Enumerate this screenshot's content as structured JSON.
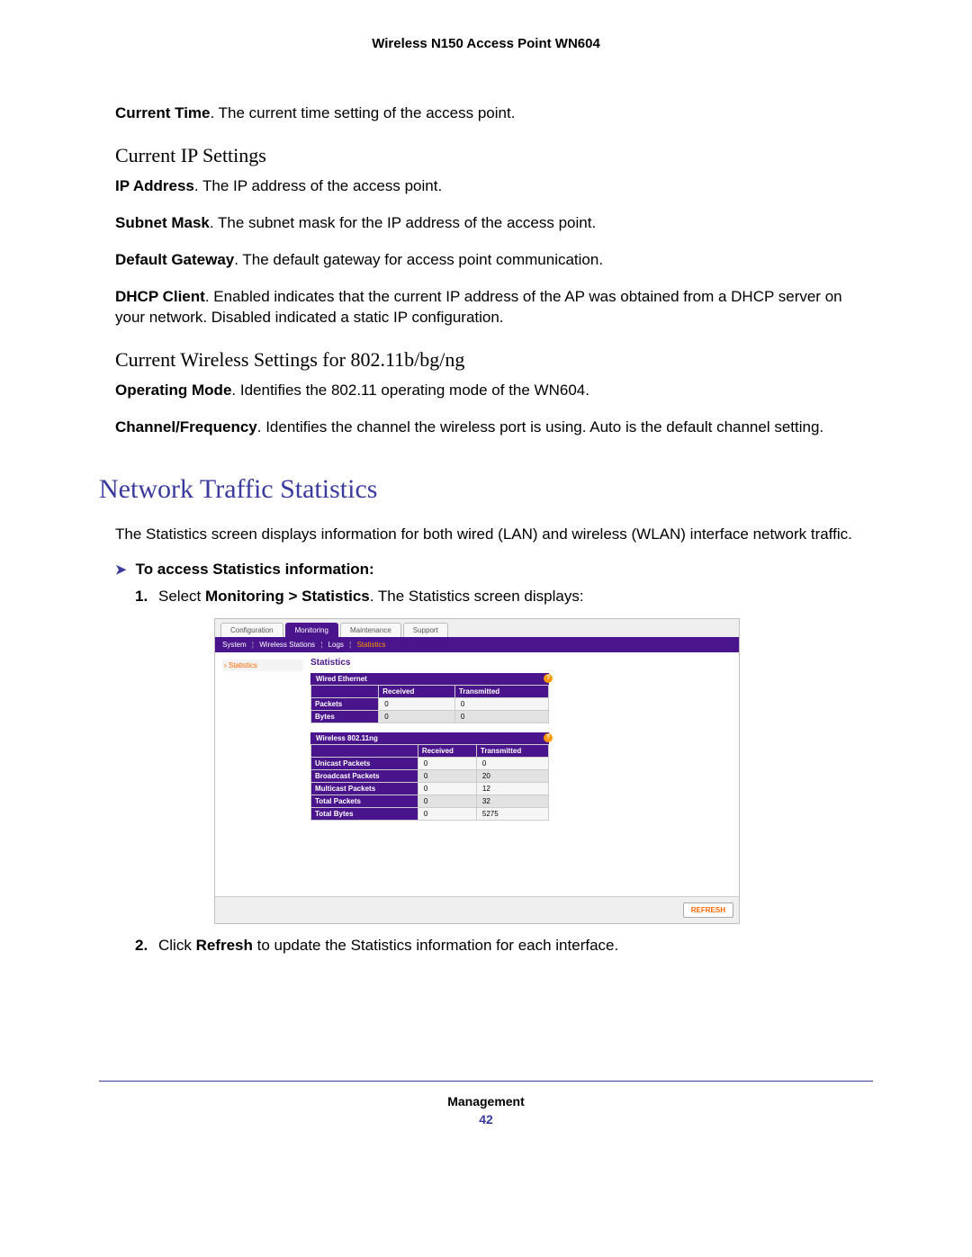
{
  "header": {
    "product": "Wireless N150 Access Point WN604"
  },
  "current_time": {
    "term": "Current Time",
    "desc": ". The current time setting of the access point."
  },
  "ip_section": {
    "heading": "Current IP Settings",
    "ip_address": {
      "term": "IP Address",
      "desc": ". The IP address of the access point."
    },
    "subnet_mask": {
      "term": "Subnet Mask",
      "desc": ". The subnet mask for the IP address of the access point."
    },
    "default_gw": {
      "term": "Default Gateway",
      "desc": ". The default gateway for access point communication."
    },
    "dhcp": {
      "term": "DHCP Client",
      "desc": ". Enabled indicates that the current IP address of the AP was obtained from a DHCP server on your network. Disabled indicated a static IP configuration."
    }
  },
  "wireless_section": {
    "heading": "Current Wireless Settings for 802.11b/bg/ng",
    "op_mode": {
      "term": "Operating Mode",
      "desc": ". Identifies the 802.11 operating mode of the WN604."
    },
    "channel": {
      "term": "Channel/Frequency",
      "desc": ". Identifies the channel the wireless port is using. Auto is the default channel setting."
    }
  },
  "stats_section": {
    "heading": "Network Traffic Statistics",
    "intro": "The Statistics screen displays information for both wired (LAN) and wireless (WLAN) interface network traffic.",
    "access_label": "To access Statistics information:",
    "step1_pre": "Select ",
    "step1_bold": "Monitoring > Statistics",
    "step1_post": ". The Statistics screen displays:",
    "step2_pre": "Click ",
    "step2_bold": "Refresh",
    "step2_post": " to update the Statistics information for each interface."
  },
  "shot": {
    "tabs": {
      "configuration": "Configuration",
      "monitoring": "Monitoring",
      "maintenance": "Maintenance",
      "support": "Support"
    },
    "subnav": {
      "system": "System",
      "wireless_stations": "Wireless Stations",
      "logs": "Logs",
      "statistics": "Statistics"
    },
    "sidebar": {
      "statistics": "Statistics"
    },
    "panel_title": "Statistics",
    "wired": {
      "title": "Wired Ethernet",
      "cols": {
        "received": "Received",
        "transmitted": "Transmitted"
      },
      "rows": [
        {
          "label": "Packets",
          "rx": "0",
          "tx": "0"
        },
        {
          "label": "Bytes",
          "rx": "0",
          "tx": "0"
        }
      ]
    },
    "wireless": {
      "title": "Wireless 802.11ng",
      "cols": {
        "received": "Received",
        "transmitted": "Transmitted"
      },
      "rows": [
        {
          "label": "Unicast Packets",
          "rx": "0",
          "tx": "0"
        },
        {
          "label": "Broadcast Packets",
          "rx": "0",
          "tx": "20"
        },
        {
          "label": "Multicast Packets",
          "rx": "0",
          "tx": "12"
        },
        {
          "label": "Total Packets",
          "rx": "0",
          "tx": "32"
        },
        {
          "label": "Total Bytes",
          "rx": "0",
          "tx": "5275"
        }
      ]
    },
    "refresh": "REFRESH"
  },
  "footer": {
    "section": "Management",
    "page": "42"
  }
}
